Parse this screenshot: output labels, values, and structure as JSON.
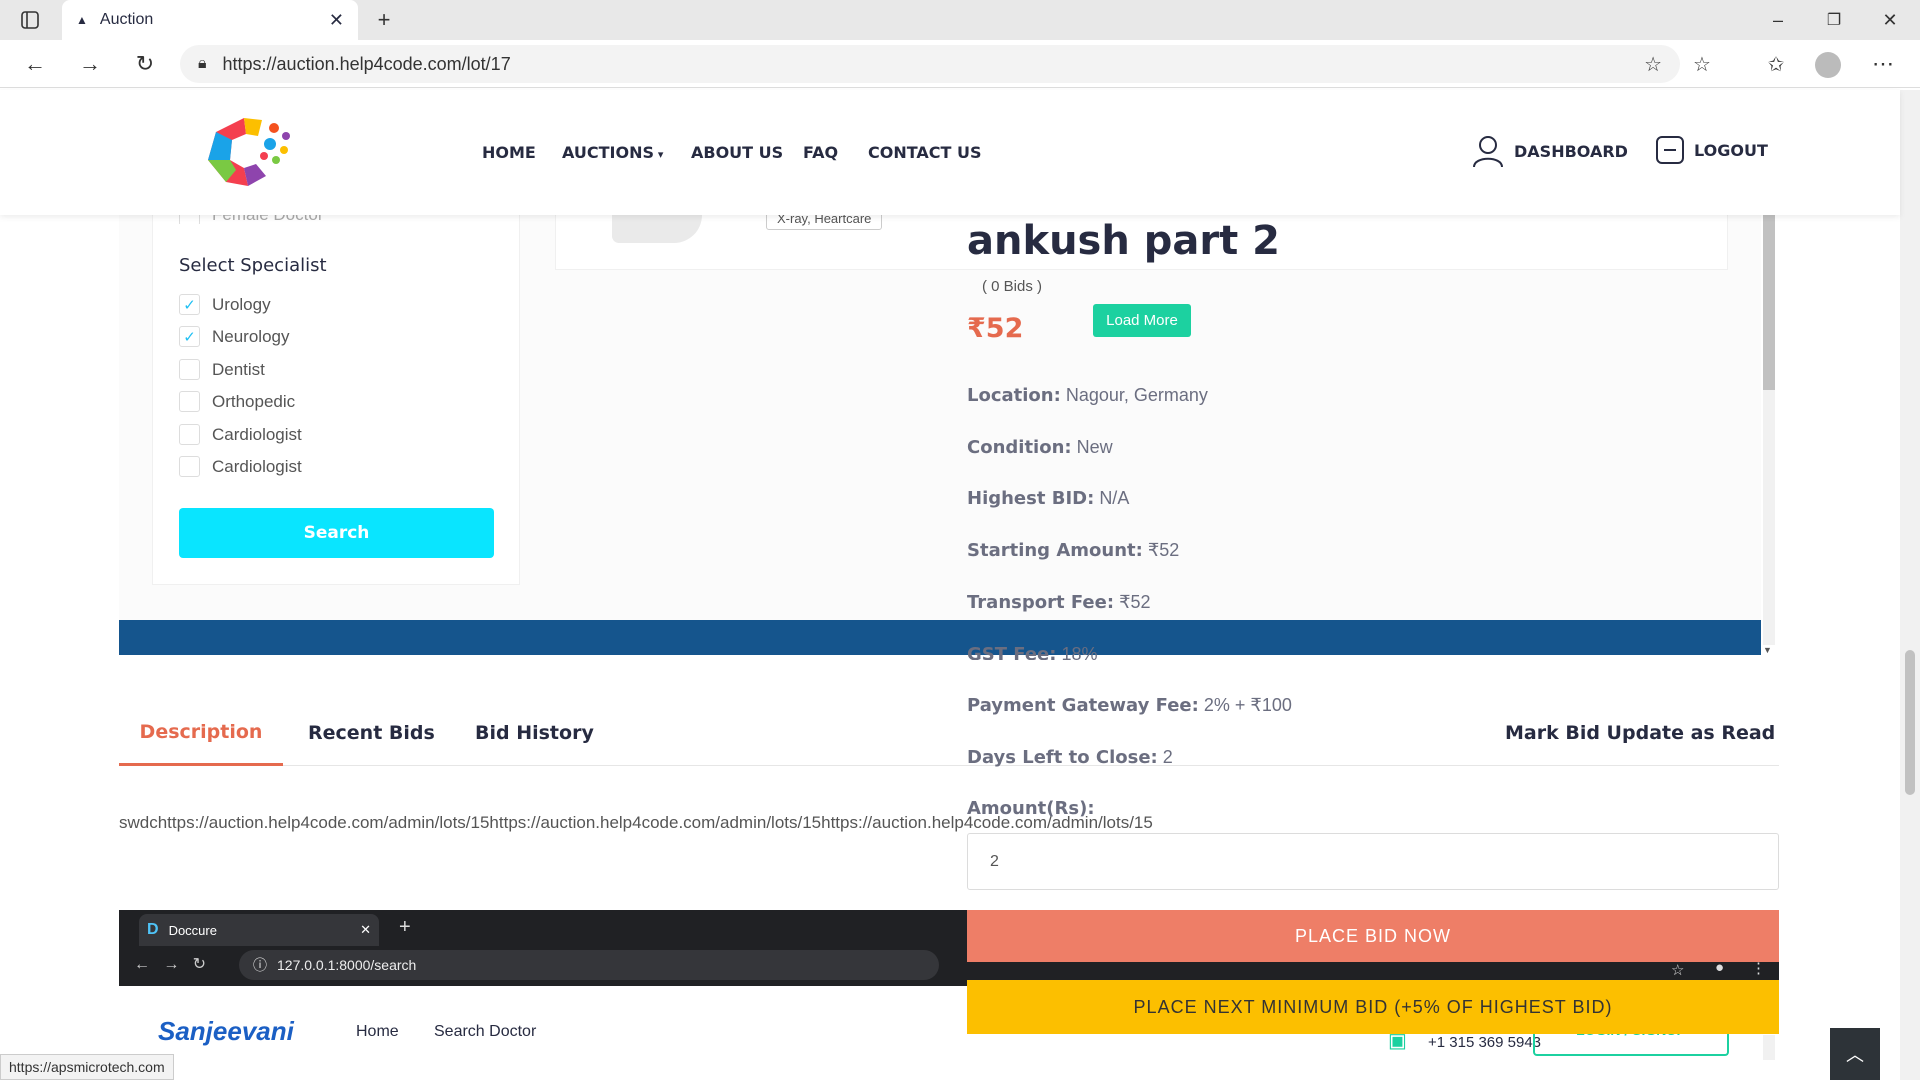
{
  "browser": {
    "tab_title": "Auction",
    "url": "https://auction.help4code.com/lot/17",
    "status_url": "https://apsmicrotech.com"
  },
  "nav": {
    "home": "HOME",
    "auctions": "AUCTIONS",
    "about": "ABOUT US",
    "faq": "FAQ",
    "contact": "CONTACT US",
    "dashboard": "DASHBOARD",
    "logout": "LOGOUT"
  },
  "sidebar": {
    "partial_label": "Female Doctor",
    "heading": "Select Specialist",
    "items": [
      {
        "label": "Urology",
        "checked": true
      },
      {
        "label": "Neurology",
        "checked": true
      },
      {
        "label": "Dentist",
        "checked": false
      },
      {
        "label": "Orthopedic",
        "checked": false
      },
      {
        "label": "Cardiologist",
        "checked": false
      },
      {
        "label": "Cardiologist",
        "checked": false
      }
    ],
    "search_label": "Search"
  },
  "card": {
    "tag": "X-ray, Heartcare"
  },
  "lot": {
    "title": "ankush part 2",
    "bids": "( 0 Bids )",
    "price": "₹52",
    "load_more": "Load More",
    "location_label": "Location:",
    "location": "Nagour, Germany",
    "condition_label": "Condition:",
    "condition": "New",
    "highest_label": "Highest BID:",
    "highest": "N/A",
    "starting_label": "Starting Amount:",
    "starting": "₹52",
    "transport_label": "Transport Fee:",
    "transport": "₹52",
    "gst_label": "GST Fee:",
    "gst": "18%",
    "gateway_label": "Payment Gateway Fee:",
    "gateway": "2% + ₹100",
    "days_label": "Days Left to Close:",
    "days": "2",
    "amount_label": "Amount(Rs):",
    "amount_value": "2",
    "place_bid": "PLACE BID NOW",
    "next_bid": "PLACE NEXT MINIMUM BID (+5% OF HIGHEST BID)"
  },
  "tabs": {
    "description": "Description",
    "recent": "Recent Bids",
    "history": "Bid History",
    "mark_read": "Mark Bid Update as Read"
  },
  "description_text": "swdchttps://auction.help4code.com/admin/lots/15https://auction.help4code.com/admin/lots/15https://auction.help4code.com/admin/lots/15",
  "embedded": {
    "tab": "Doccure",
    "url": "127.0.0.1:8000/search",
    "brand": "Sanjeevani",
    "home": "Home",
    "search": "Search Doctor",
    "phone": "+1 315 369 5943",
    "login": "LOGIN / SIGNUP"
  },
  "colors": {
    "accent": "#e56a4e",
    "cyan": "#09e5ff",
    "green": "#1cd1a0",
    "yellow": "#fcbf00",
    "band": "#15558d"
  }
}
